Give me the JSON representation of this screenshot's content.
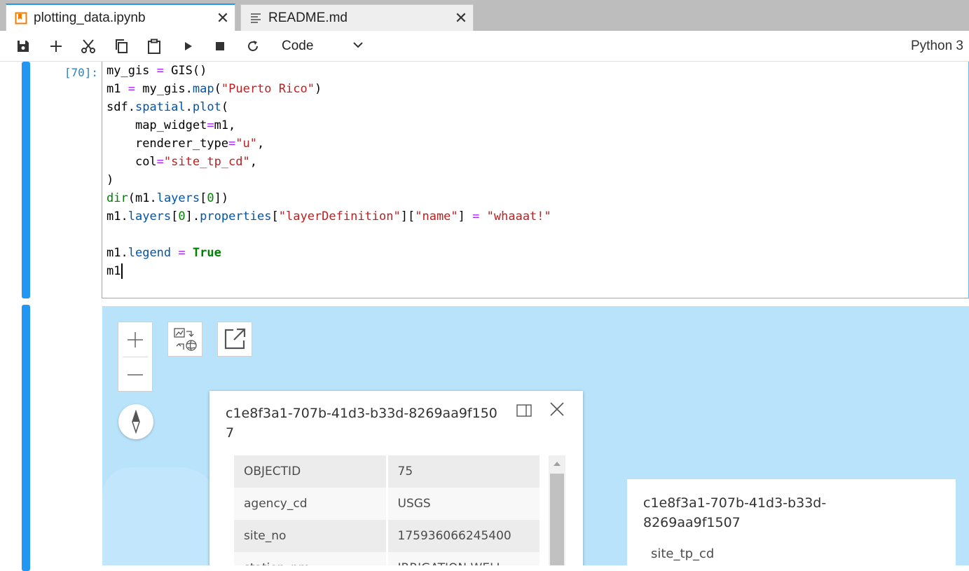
{
  "tabs": [
    {
      "label": "plotting_data.ipynb",
      "icon": "notebook-icon",
      "active": true,
      "close": "✕"
    },
    {
      "label": "README.md",
      "icon": "markdown-file-icon",
      "active": false,
      "close": "✕"
    }
  ],
  "toolbar": {
    "buttons": [
      "save-icon",
      "add-cell-icon",
      "cut-icon",
      "copy-icon",
      "paste-icon",
      "run-icon",
      "stop-icon",
      "restart-icon"
    ],
    "cell_type": "Code",
    "kernel": "Python 3"
  },
  "cell": {
    "prompt": "[70]:",
    "code_lines": [
      "my_gis = GIS()",
      "m1 = my_gis.map(\"Puerto Rico\")",
      "sdf.spatial.plot(",
      "    map_widget=m1,",
      "    renderer_type=\"u\",",
      "    col=\"site_tp_cd\",",
      ")",
      "dir(m1.layers[0])",
      "m1.layers[0].properties[\"layerDefinition\"][\"name\"] = \"whaaat!\"",
      "",
      "m1.legend = True",
      "m1"
    ]
  },
  "map": {
    "controls": [
      "zoom-in-icon",
      "zoom-out-icon",
      "swap-2d-3d-icon",
      "open-external-icon",
      "compass-icon"
    ],
    "popup": {
      "title": "c1e8f3a1-707b-41d3-b33d-8269aa9f1507",
      "attributes": [
        {
          "key": "OBJECTID",
          "value": "75"
        },
        {
          "key": "agency_cd",
          "value": "USGS"
        },
        {
          "key": "site_no",
          "value": "175936066245400"
        },
        {
          "key": "station_nm",
          "value": "IRRIGATION WELL"
        }
      ]
    },
    "legend": {
      "title": "c1e8f3a1-707b-41d3-b33d-8269aa9f1507",
      "field": "site_tp_cd"
    }
  },
  "colors": {
    "accent": "#2196f3",
    "map_water": "#b8e3fb"
  }
}
